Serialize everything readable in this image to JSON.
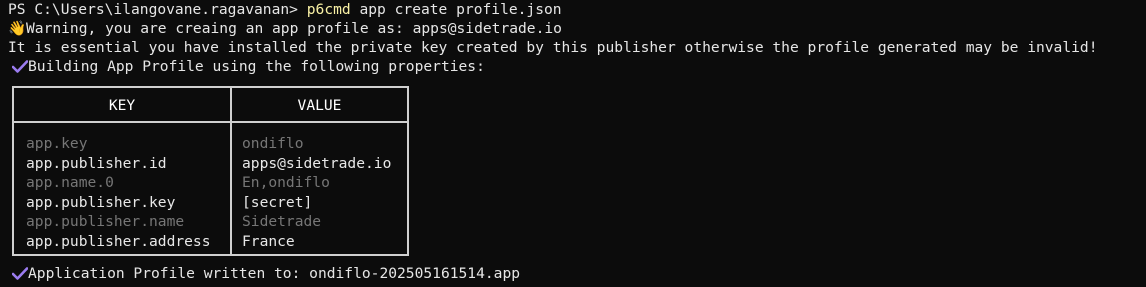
{
  "terminal": {
    "prompt": "PS C:\\Users\\ilangovane.ragavanan>",
    "command": "p6cmd",
    "args": "app create profile.json",
    "warning_icon": "waving-hand-icon",
    "warning_emoji": "👋",
    "warning": "Warning, you are creaing an app profile as: apps@sidetrade.io",
    "essential": "It is essential you have installed the private key created by this publisher otherwise the profile generated may be invalid!",
    "check_icon": "checkmark-icon",
    "building": "Building App Profile using the following properties:",
    "written": "Application Profile written to: ondiflo-202505161514.app"
  },
  "table": {
    "headers": {
      "key": "KEY",
      "value": "VALUE"
    },
    "rows": [
      {
        "key": "app.key",
        "value": "ondiflo",
        "style": "dim"
      },
      {
        "key": "app.publisher.id",
        "value": "apps@sidetrade.io",
        "style": "bright"
      },
      {
        "key": "app.name.0",
        "value": "En,ondiflo",
        "style": "dim"
      },
      {
        "key": "app.publisher.key",
        "value": "[secret]",
        "style": "bright"
      },
      {
        "key": "app.publisher.name",
        "value": "Sidetrade",
        "style": "dim"
      },
      {
        "key": "app.publisher.address",
        "value": "France",
        "style": "bright"
      }
    ]
  },
  "colors": {
    "background": "#0c0c0c",
    "text": "#e6e6e6",
    "command": "#f9f1a5",
    "check": "#9b7cf0",
    "dim_row": "#767676"
  }
}
